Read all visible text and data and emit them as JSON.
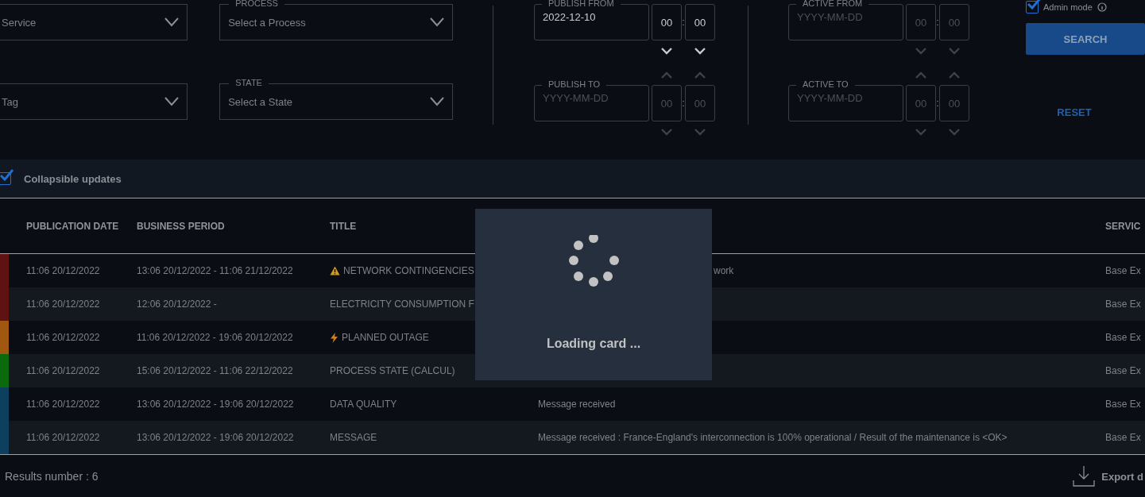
{
  "admin_mode": {
    "label": "Admin mode",
    "checked": true
  },
  "selects": [
    {
      "placeholder": "Service"
    },
    {
      "label": "PROCESS",
      "placeholder": "Select a Process"
    },
    {
      "placeholder": "Tag"
    },
    {
      "label": "STATE",
      "placeholder": "Select a State"
    }
  ],
  "date_filters": [
    {
      "label": "PUBLISH FROM",
      "value": "2022-12-10",
      "hour": "00",
      "minute": "00",
      "separator": ":"
    },
    {
      "label": "PUBLISH TO",
      "placeholder": "YYYY-MM-DD",
      "hour_placeholder": "00",
      "minute_placeholder": "00",
      "separator": ":"
    },
    {
      "label": "ACTIVE FROM",
      "placeholder": "YYYY-MM-DD",
      "hour_placeholder": "00",
      "minute_placeholder": "00",
      "separator": ":"
    },
    {
      "label": "ACTIVE TO",
      "placeholder": "YYYY-MM-DD",
      "hour_placeholder": "00",
      "minute_placeholder": "00",
      "separator": ":"
    }
  ],
  "search_button": "SEARCH",
  "reset_button": "RESET",
  "collapsible": {
    "label": "Collapsible updates",
    "checked": true
  },
  "table": {
    "columns": [
      {
        "label": "PUBLICATION DATE"
      },
      {
        "label": "BUSINESS PERIOD"
      },
      {
        "label": "TITLE"
      },
      {
        "label": "SERVIC"
      }
    ],
    "rows": [
      {
        "color": "#5e1212",
        "publication_date": "11:06 20/12/2022",
        "business_period": "13:06 20/12/2022 - 11:06 21/12/2022",
        "kind": "warning",
        "title": "NETWORK CONTINGENCIES",
        "summary": "work",
        "service": "Base Ex"
      },
      {
        "color": "#5e1212",
        "publication_date": "11:06 20/12/2022",
        "business_period": "12:06 20/12/2022 -",
        "title": "ELECTRICITY CONSUMPTION F",
        "service": "Base Ex"
      },
      {
        "color": "#a0570f",
        "publication_date": "11:06 20/12/2022",
        "business_period": "11:06 20/12/2022 - 19:06 20/12/2022",
        "kind": "lightning",
        "title": "PLANNED OUTAGE",
        "service": "Base Ex"
      },
      {
        "color": "#0b6a0b",
        "publication_date": "11:06 20/12/2022",
        "business_period": "15:06 20/12/2022 - 11:06 22/12/2022",
        "title": "PROCESS STATE (CALCUL)",
        "service": "Base Ex"
      },
      {
        "color": "#0d3f5f",
        "publication_date": "11:06 20/12/2022",
        "business_period": "13:06 20/12/2022 - 19:06 20/12/2022",
        "title": "DATA QUALITY",
        "summary": "Message received",
        "service": "Base Ex"
      },
      {
        "color": "#0d3f5f",
        "publication_date": "11:06 20/12/2022",
        "business_period": "13:06 20/12/2022 - 19:06 20/12/2022",
        "title": "MESSAGE",
        "summary": "Message received : France-England's interconnection is 100% operational / Result of the maintenance is <OK>",
        "service": "Base Ex"
      }
    ]
  },
  "loading": {
    "text": "Loading card ..."
  },
  "footer": {
    "results": "Results number : 6",
    "export": "Export d"
  }
}
